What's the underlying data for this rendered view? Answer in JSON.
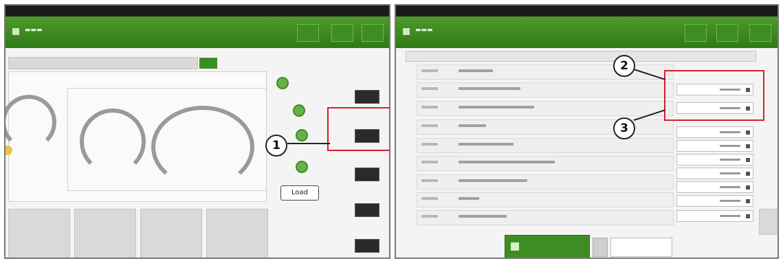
{
  "left_screen": {
    "callout": "1",
    "button": "Load"
  },
  "right_screen": {
    "callouts": [
      "2",
      "3"
    ]
  },
  "colors": {
    "header_green": "#3e8d23",
    "highlight_red": "#d41f2a",
    "callout_border": "#222222"
  }
}
